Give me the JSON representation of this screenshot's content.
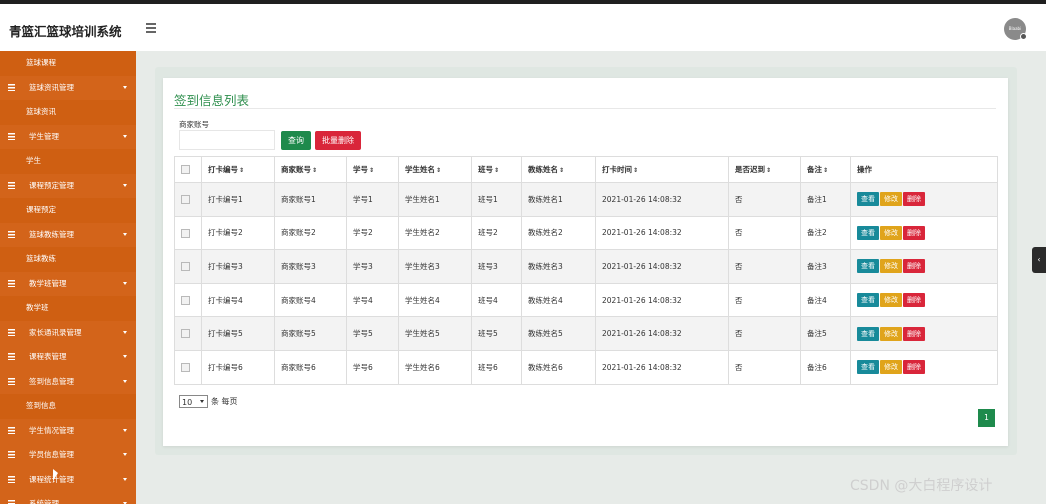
{
  "app": {
    "title": "青篮汇篮球培训系统",
    "avatar_text": "Blaabi"
  },
  "sidebar": {
    "items": [
      {
        "label": "篮球课程",
        "type": "sub"
      },
      {
        "label": "篮球资讯管理",
        "type": "group"
      },
      {
        "label": "篮球资讯",
        "type": "sub"
      },
      {
        "label": "学生管理",
        "type": "group"
      },
      {
        "label": "学生",
        "type": "sub"
      },
      {
        "label": "课程预定管理",
        "type": "group"
      },
      {
        "label": "课程预定",
        "type": "sub"
      },
      {
        "label": "篮球教练管理",
        "type": "group"
      },
      {
        "label": "篮球教练",
        "type": "sub"
      },
      {
        "label": "教学班管理",
        "type": "group"
      },
      {
        "label": "教学班",
        "type": "sub"
      },
      {
        "label": "家长通讯录管理",
        "type": "group"
      },
      {
        "label": "课程表管理",
        "type": "group"
      },
      {
        "label": "签到信息管理",
        "type": "group"
      },
      {
        "label": "签到信息",
        "type": "sub"
      },
      {
        "label": "学生情况管理",
        "type": "group"
      },
      {
        "label": "学员信息管理",
        "type": "group"
      },
      {
        "label": "课程统计管理",
        "type": "group"
      },
      {
        "label": "系统管理",
        "type": "group"
      }
    ]
  },
  "page": {
    "title": "签到信息列表",
    "search": {
      "label": "商家账号",
      "value": "",
      "placeholder": ""
    },
    "query_button": "查询",
    "batch_delete_button": "批量删除",
    "columns": [
      "打卡编号",
      "商家账号",
      "学号",
      "学生姓名",
      "班号",
      "教练姓名",
      "打卡时间",
      "是否迟到",
      "备注",
      "操作"
    ],
    "sort_mark": "⇕",
    "rows": [
      [
        "打卡编号1",
        "商家账号1",
        "学号1",
        "学生姓名1",
        "班号1",
        "教练姓名1",
        "2021-01-26 14:08:32",
        "否",
        "备注1"
      ],
      [
        "打卡编号2",
        "商家账号2",
        "学号2",
        "学生姓名2",
        "班号2",
        "教练姓名2",
        "2021-01-26 14:08:32",
        "否",
        "备注2"
      ],
      [
        "打卡编号3",
        "商家账号3",
        "学号3",
        "学生姓名3",
        "班号3",
        "教练姓名3",
        "2021-01-26 14:08:32",
        "否",
        "备注3"
      ],
      [
        "打卡编号4",
        "商家账号4",
        "学号4",
        "学生姓名4",
        "班号4",
        "教练姓名4",
        "2021-01-26 14:08:32",
        "否",
        "备注4"
      ],
      [
        "打卡编号5",
        "商家账号5",
        "学号5",
        "学生姓名5",
        "班号5",
        "教练姓名5",
        "2021-01-26 14:08:32",
        "否",
        "备注5"
      ],
      [
        "打卡编号6",
        "商家账号6",
        "学号6",
        "学生姓名6",
        "班号6",
        "教练姓名6",
        "2021-01-26 14:08:32",
        "否",
        "备注6"
      ]
    ],
    "row_actions": {
      "view": "查看",
      "edit": "修改",
      "delete": "删除"
    },
    "pager": {
      "page_size": "10",
      "per_page_label": "条 每页",
      "current_page": "1"
    }
  },
  "watermark": "CSDN @大白程序设计",
  "colors": {
    "sidebar": "#d9691c",
    "primary_green": "#1e8a4c",
    "danger": "#d9263a",
    "info": "#188a9a",
    "warning": "#e0a41b"
  }
}
